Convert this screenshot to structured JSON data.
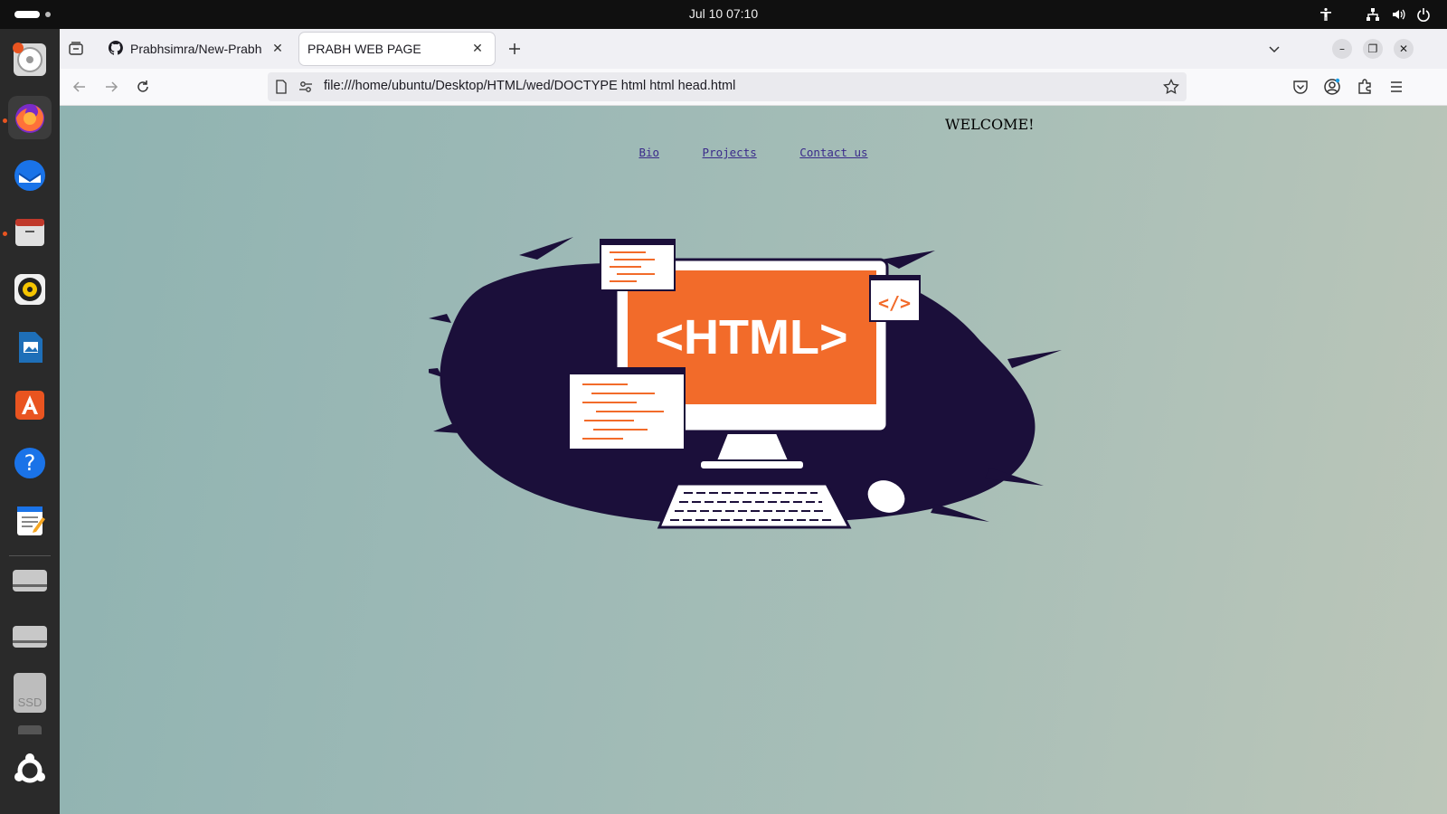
{
  "system": {
    "clock": "Jul 10  07:10"
  },
  "dock": {
    "apps": [
      "ubuntu-installer-icon",
      "firefox-icon",
      "thunderbird-icon",
      "files-icon",
      "rhythmbox-icon",
      "writer-icon",
      "app-center-icon",
      "help-icon",
      "text-editor-icon",
      "drive-icon",
      "drive-icon",
      "ssd-drive-icon",
      "show-apps-icon"
    ],
    "ssd_label": "SSD"
  },
  "browser": {
    "tabs": [
      {
        "title": "Prabhsimra/New-Prabh",
        "active": false
      },
      {
        "title": "PRABH WEB PAGE",
        "active": true
      }
    ],
    "url": "file:///home/ubuntu/Desktop/HTML/wed/DOCTYPE html html head.html"
  },
  "page": {
    "welcome": "WELCOME!",
    "links": [
      "Bio",
      "Projects",
      "Contact us"
    ],
    "hero_text": "<HTML>",
    "hero_tag": "</>"
  },
  "colors": {
    "accent": "#f26b2a",
    "ink": "#1b0f3a",
    "ubuntu": "#e95420"
  }
}
